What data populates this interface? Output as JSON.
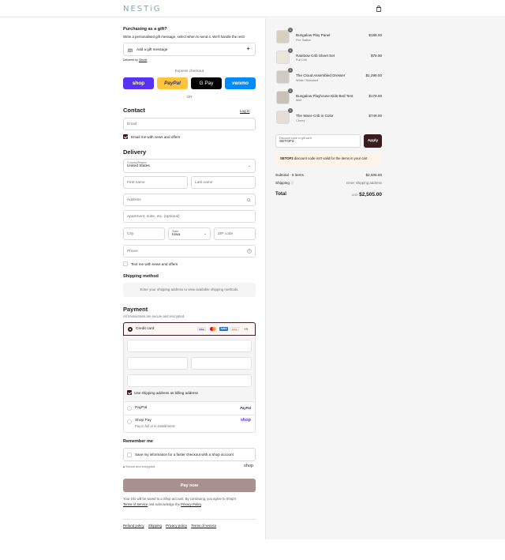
{
  "header": {
    "logo": "NESTiG",
    "cart_icon": "shopping-bag-icon"
  },
  "gift": {
    "title": "Purchasing as a gift?",
    "subtitle": "Write a personalised gift message, select when to send it. We'll handle the rest!",
    "add_label": "Add a gift message",
    "delivered_by_prefix": "Delivered by",
    "delivered_by_link": "Gitsuie"
  },
  "express": {
    "label": "Express checkout",
    "shop": "shop",
    "paypal": "PayPal",
    "gpay": "G Pay",
    "venmo": "venmo",
    "or": "OR"
  },
  "contact": {
    "title": "Contact",
    "login": "Log in",
    "email_placeholder": "Email",
    "news_label": "Email me with news and offers",
    "news_checked": true
  },
  "delivery": {
    "title": "Delivery",
    "country_label": "Country/Region",
    "country_value": "United States",
    "first_name": "First name",
    "last_name": "Last name",
    "address": "Address",
    "apartment": "Apartment, suite, etc. (optional)",
    "city": "City",
    "state_label": "State",
    "state_value": "Iowa",
    "zip": "ZIP code",
    "phone": "Phone",
    "text_label": "Text me with news and offers",
    "text_checked": false
  },
  "shipping": {
    "title": "Shipping method",
    "message": "Enter your shipping address to view available shipping methods."
  },
  "payment": {
    "title": "Payment",
    "subtitle": "All transactions are secure and encrypted.",
    "credit_card": "Credit card",
    "card_brands": [
      "VISA",
      "MC",
      "AMEX",
      "DISC"
    ],
    "more_cards": "+4",
    "billing_label": "Use shipping address as billing address",
    "paypal": "PayPal",
    "paypal_logo": "PayPal",
    "shoppay": "Shop Pay",
    "shoppay_sub": "Pay in full or in installments",
    "shoppay_logo": "shop"
  },
  "remember": {
    "title": "Remember me",
    "save_label": "Save my information for a faster checkout with a Shop account",
    "secure": "Secure and encrypted",
    "shop_logo": "shop"
  },
  "pay_now": "Pay now",
  "legal": {
    "line1": "Your info will be saved to a Shop account. By continuing, you agree to Shop's",
    "terms": "Terms of Service",
    "and": "and acknowledge the",
    "privacy": "Privacy Policy",
    "end": "."
  },
  "footer_links": [
    "Refund policy",
    "Shipping",
    "Privacy policy",
    "Terms of service"
  ],
  "order": {
    "items": [
      {
        "qty": "1",
        "name": "Bungalow Play Panel",
        "variant": "Fire Station",
        "price": "$199.00",
        "thumb": "#d9cfc0"
      },
      {
        "qty": "1",
        "name": "Rainbow Crib Sheet Set",
        "variant": "Full Crib",
        "price": "$79.00",
        "thumb": "#ebe6dc"
      },
      {
        "qty": "1",
        "name": "The Cloud Assembled Dresser",
        "variant": "White / Standard",
        "price": "$1,299.00",
        "thumb": "#cfcac4"
      },
      {
        "qty": "1",
        "name": "Bungalow Playhouse Kids Bed Tent",
        "variant": "Mint",
        "price": "$179.00",
        "thumb": "#c9c2b6"
      },
      {
        "qty": "1",
        "name": "The Wave Crib in Color",
        "variant": "Cherry",
        "price": "$749.00",
        "thumb": "#e6ddd6"
      }
    ],
    "discount_label": "Discount code or gift card",
    "discount_value": "SETOF2",
    "apply": "Apply",
    "error_code": "SETOF2",
    "error_text": "discount code isn't valid for the items in your cart",
    "subtotal_label": "Subtotal · 5 items",
    "subtotal_value": "$2,505.00",
    "shipping_label": "Shipping",
    "shipping_value": "Enter shipping address",
    "total_label": "Total",
    "currency": "USD",
    "total_value": "$2,505.00"
  },
  "colors": {
    "accent": "#3b1a20",
    "shop_purple": "#5a31f4",
    "paypal_yellow": "#ffc439",
    "venmo_blue": "#008cff",
    "pay_button": "#a8918f",
    "error_bg": "#fff4e8"
  }
}
